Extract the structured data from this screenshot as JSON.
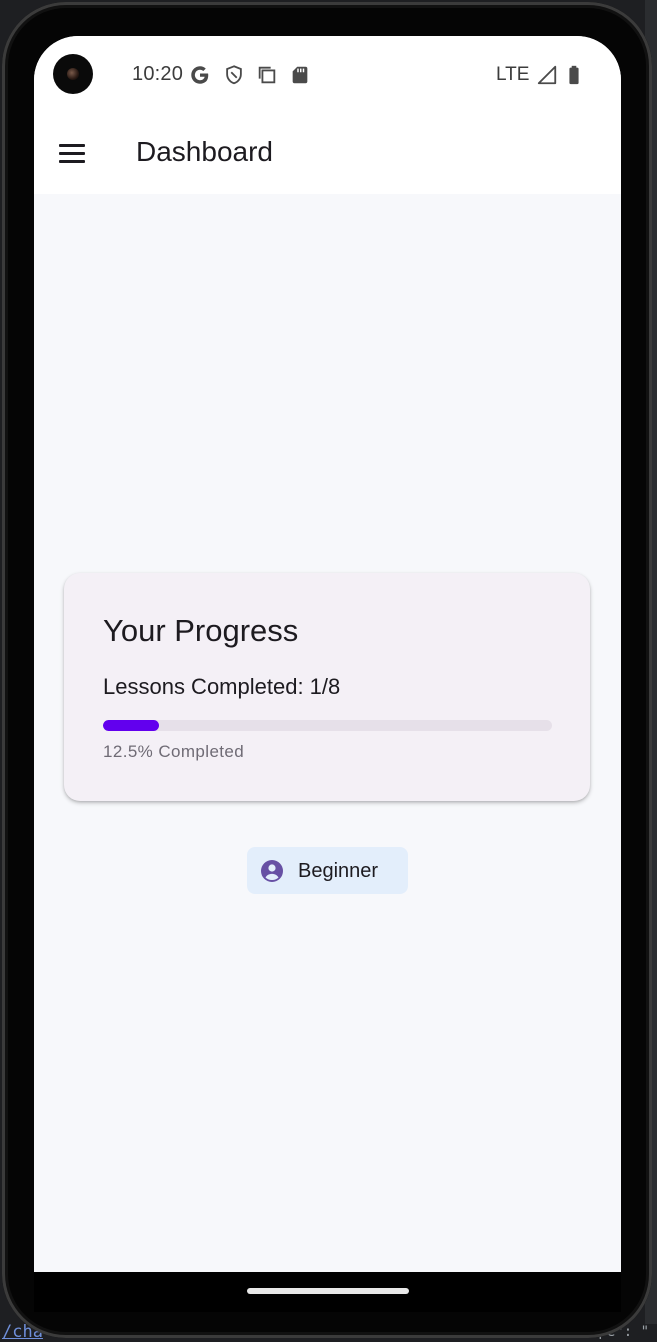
{
  "status_bar": {
    "time": "10:20",
    "network": "LTE"
  },
  "app_bar": {
    "title": "Dashboard",
    "menu_icon": "menu-icon"
  },
  "progress_card": {
    "title": "Your Progress",
    "lessons_text": "Lessons Completed: 1/8",
    "progress_fraction": 0.125,
    "caption": "12.5% Completed",
    "accent_color": "#6200ee"
  },
  "level_chip": {
    "label": "Beginner",
    "icon": "account-circle-icon"
  },
  "ide_background": {
    "left_text": "/cha",
    "right_text": "pe\": \""
  }
}
